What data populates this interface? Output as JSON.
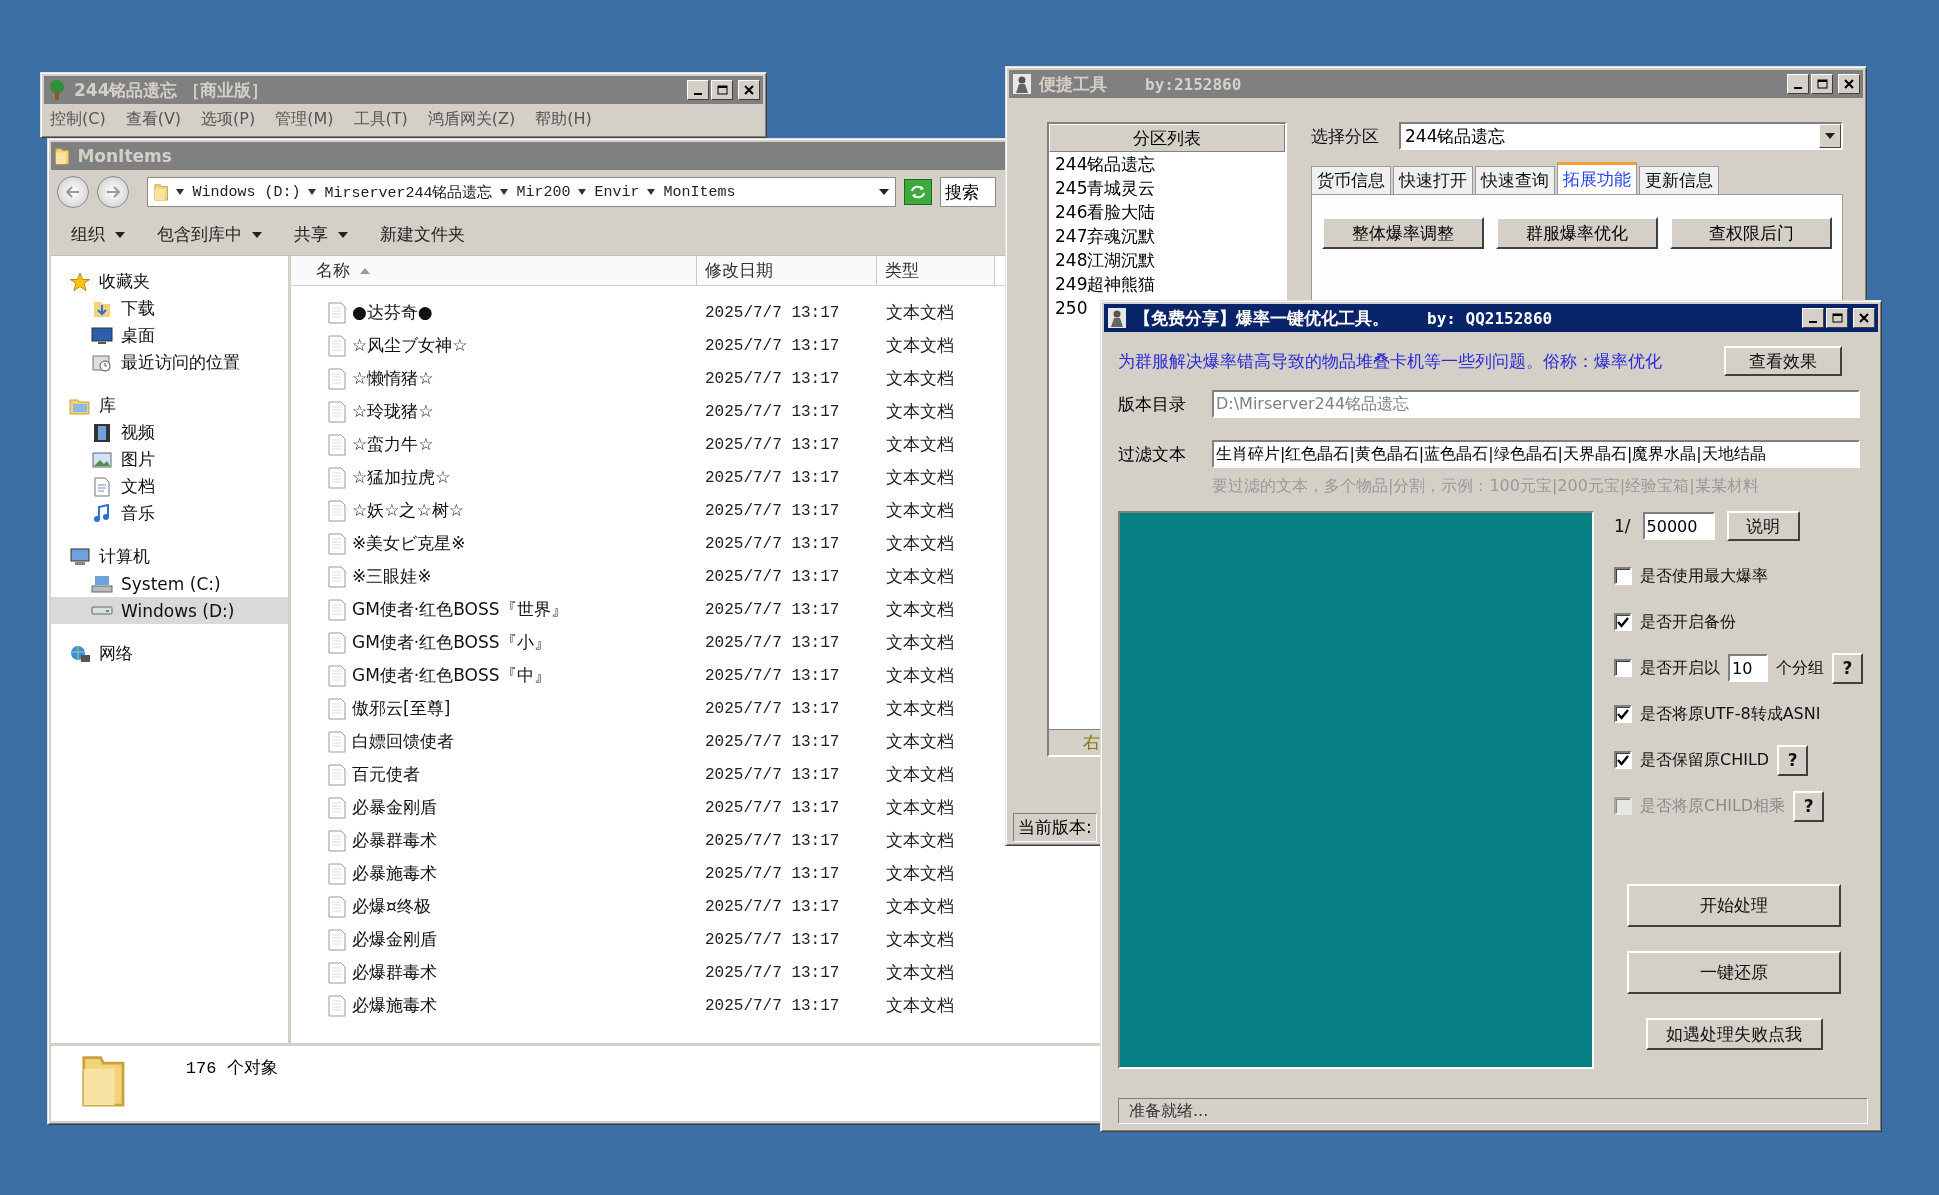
{
  "main_window": {
    "title": "244铭品遗忘 ［商业版］",
    "active": false,
    "menu": [
      "控制(C)",
      "查看(V)",
      "选项(P)",
      "管理(M)",
      "工具(T)",
      "鸿盾网关(Z)",
      "帮助(H)"
    ]
  },
  "explorer": {
    "title": "MonItems",
    "active": false,
    "breadcrumb": [
      "Windows (D:)",
      "Mirserver244铭品遗忘",
      "Mir200",
      "Envir",
      "MonItems"
    ],
    "search": {
      "placeholder": "搜索"
    },
    "toolbar": [
      {
        "label": "组织",
        "dropdown": true
      },
      {
        "label": "包含到库中",
        "dropdown": true
      },
      {
        "label": "共享",
        "dropdown": true
      },
      {
        "label": "新建文件夹",
        "dropdown": false
      }
    ],
    "nav": [
      {
        "label": "收藏夹",
        "kind": "star",
        "selected": false,
        "children": [
          {
            "label": "下载",
            "kind": "download",
            "selected": false
          },
          {
            "label": "桌面",
            "kind": "desktop",
            "selected": false
          },
          {
            "label": "最近访问的位置",
            "kind": "recent",
            "selected": false
          }
        ]
      },
      {
        "label": "库",
        "kind": "library",
        "selected": false,
        "children": [
          {
            "label": "视频",
            "kind": "video",
            "selected": false
          },
          {
            "label": "图片",
            "kind": "picture",
            "selected": false
          },
          {
            "label": "文档",
            "kind": "document",
            "selected": false
          },
          {
            "label": "音乐",
            "kind": "music",
            "selected": false
          }
        ]
      },
      {
        "label": "计算机",
        "kind": "computer",
        "selected": false,
        "children": [
          {
            "label": "System (C:)",
            "kind": "system-drive",
            "selected": false
          },
          {
            "label": "Windows (D:)",
            "kind": "drive",
            "selected": true
          }
        ]
      },
      {
        "label": "网络",
        "kind": "network",
        "selected": false
      }
    ],
    "columns": [
      {
        "label": "名称",
        "sorted": true
      },
      {
        "label": "修改日期",
        "sorted": false
      },
      {
        "label": "类型",
        "sorted": false
      }
    ],
    "rows": [
      {
        "name": "●达芬奇●",
        "modified": "2025/7/7 13:17",
        "type": "文本文档"
      },
      {
        "name": "☆风尘ブ女神☆",
        "modified": "2025/7/7 13:17",
        "type": "文本文档"
      },
      {
        "name": "☆懒惰猪☆",
        "modified": "2025/7/7 13:17",
        "type": "文本文档"
      },
      {
        "name": "☆玲珑猪☆",
        "modified": "2025/7/7 13:17",
        "type": "文本文档"
      },
      {
        "name": "☆蛮力牛☆",
        "modified": "2025/7/7 13:17",
        "type": "文本文档"
      },
      {
        "name": "☆猛加拉虎☆",
        "modified": "2025/7/7 13:17",
        "type": "文本文档"
      },
      {
        "name": "☆妖☆之☆树☆",
        "modified": "2025/7/7 13:17",
        "type": "文本文档"
      },
      {
        "name": "※美女ビ克星※",
        "modified": "2025/7/7 13:17",
        "type": "文本文档"
      },
      {
        "name": "※三眼娃※",
        "modified": "2025/7/7 13:17",
        "type": "文本文档"
      },
      {
        "name": "GM使者·红色BOSS『世界』",
        "modified": "2025/7/7 13:17",
        "type": "文本文档"
      },
      {
        "name": "GM使者·红色BOSS『小』",
        "modified": "2025/7/7 13:17",
        "type": "文本文档"
      },
      {
        "name": "GM使者·红色BOSS『中』",
        "modified": "2025/7/7 13:17",
        "type": "文本文档"
      },
      {
        "name": "傲邪云[至尊]",
        "modified": "2025/7/7 13:17",
        "type": "文本文档"
      },
      {
        "name": "白嫖回馈使者",
        "modified": "2025/7/7 13:17",
        "type": "文本文档"
      },
      {
        "name": "百元使者",
        "modified": "2025/7/7 13:17",
        "type": "文本文档"
      },
      {
        "name": "必暴金刚盾",
        "modified": "2025/7/7 13:17",
        "type": "文本文档"
      },
      {
        "name": "必暴群毒术",
        "modified": "2025/7/7 13:17",
        "type": "文本文档"
      },
      {
        "name": "必暴施毒术",
        "modified": "2025/7/7 13:17",
        "type": "文本文档"
      },
      {
        "name": "必爆¤终极",
        "modified": "2025/7/7 13:17",
        "type": "文本文档"
      },
      {
        "name": "必爆金刚盾",
        "modified": "2025/7/7 13:17",
        "type": "文本文档"
      },
      {
        "name": "必爆群毒术",
        "modified": "2025/7/7 13:17",
        "type": "文本文档"
      },
      {
        "name": "必爆施毒术",
        "modified": "2025/7/7 13:17",
        "type": "文本文档"
      }
    ],
    "status": "176 个对象"
  },
  "tool_window": {
    "title": "便捷工具",
    "author": "by:2152860",
    "active": false,
    "list_header": "分区列表",
    "list": [
      "244铭品遗忘",
      "245青城灵云",
      "246看脸大陆",
      "247弃魂沉默",
      "248江湖沉默",
      "249超神熊猫",
      "250"
    ],
    "list_footer": "右",
    "select_label": "选择分区",
    "select_value": "244铭品遗忘",
    "tabs": [
      {
        "label": "货币信息",
        "selected": false
      },
      {
        "label": "快速打开",
        "selected": false
      },
      {
        "label": "快速查询",
        "selected": false
      },
      {
        "label": "拓展功能",
        "selected": true
      },
      {
        "label": "更新信息",
        "selected": false
      }
    ],
    "buttons": [
      "整体爆率调整",
      "群服爆率优化",
      "查权限后门"
    ],
    "version_label": "当前版本:"
  },
  "optimizer": {
    "title": "【免费分享】爆率一键优化工具。",
    "author": "by: QQ2152860",
    "active": true,
    "description": "为群服解决爆率错高导致的物品堆叠卡机等一些列问题。俗称：爆率优化",
    "view_button": "查看效果",
    "fields": [
      {
        "label": "版本目录",
        "value": "D:\\Mirserver244铭品遗忘",
        "disabled": true
      },
      {
        "label": "过滤文本",
        "value": "生肖碎片|红色晶石|黄色晶石|蓝色晶石|绿色晶石|天界晶石|魔界水晶|天地结晶",
        "disabled": false
      }
    ],
    "hint": "要过滤的文本，多个物品|分割，示例：100元宝|200元宝|经验宝箱|某某材料",
    "rate": {
      "prefix": "1/",
      "value": "50000",
      "button": "说明"
    },
    "options": [
      {
        "kind": "plain",
        "label": "是否使用最大爆率",
        "checked": false,
        "disabled": false
      },
      {
        "kind": "plain",
        "label": "是否开启备份",
        "checked": true,
        "disabled": false
      },
      {
        "kind": "count",
        "label": "是否开启以",
        "value": "10",
        "suffix": "个分组",
        "help": "?",
        "checked": false,
        "disabled": false
      },
      {
        "kind": "plain",
        "label": "是否将原UTF-8转成ASNI",
        "checked": true,
        "disabled": false
      },
      {
        "kind": "plain",
        "label": "是否保留原CHILD",
        "help": "?",
        "checked": true,
        "disabled": false
      },
      {
        "kind": "plain",
        "label": "是否将原CHILD相乘",
        "help": "?",
        "checked": false,
        "disabled": true
      }
    ],
    "actions": [
      {
        "label": "开始处理",
        "kind": "large"
      },
      {
        "label": "一键还原",
        "kind": "large"
      },
      {
        "label": "如遇处理失败点我",
        "kind": "small"
      }
    ],
    "status": "准备就绪..."
  }
}
